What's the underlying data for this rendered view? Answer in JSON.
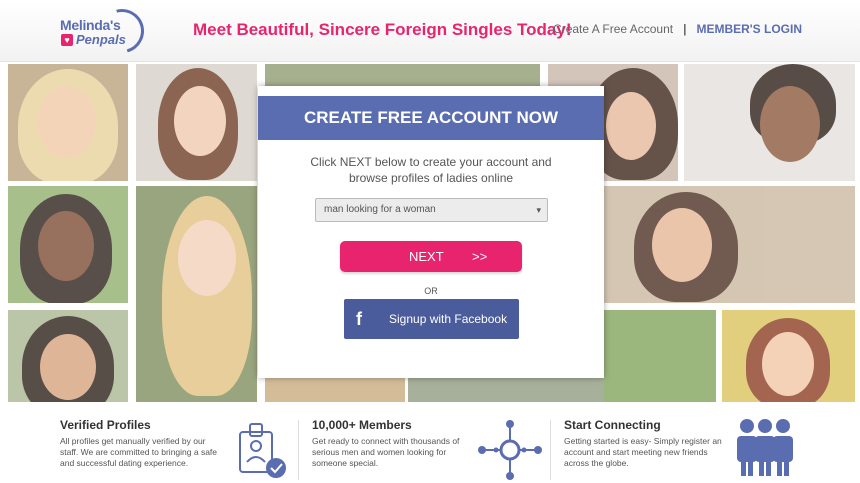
{
  "header": {
    "logo_line1": "Melinda's",
    "logo_line2": "Penpals",
    "tagline": "Meet Beautiful, Sincere Foreign Singles Today!",
    "nav": {
      "create_account": "Create A Free Account",
      "separator": "|",
      "members_login": "MEMBER'S LOGIN"
    }
  },
  "modal": {
    "title": "CREATE FREE ACCOUNT NOW",
    "intro": "Click NEXT below to create your account and browse profiles of ladies online",
    "select": {
      "value": "man looking for a woman"
    },
    "next_label": "NEXT",
    "next_arrows": ">>",
    "or_label": "OR",
    "facebook_icon": "f",
    "facebook_label": "Signup with Facebook"
  },
  "features": [
    {
      "title": "Verified Profiles",
      "text": "All profiles get manually verified by our staff. We are committed to bringing a safe and successful dating experience.",
      "icon": "verified-id-badge-icon"
    },
    {
      "title": "10,000+ Members",
      "text": "Get ready to connect with thousands of serious men and women looking for someone special.",
      "icon": "network-hub-icon"
    },
    {
      "title": "Start Connecting",
      "text": "Getting started is easy- Simply register an account and start meeting new friends across the globe.",
      "icon": "people-group-icon"
    }
  ],
  "colors": {
    "brand_pink": "#e8246f",
    "brand_blue": "#5b6db1",
    "facebook_blue": "#4a5c9b"
  }
}
